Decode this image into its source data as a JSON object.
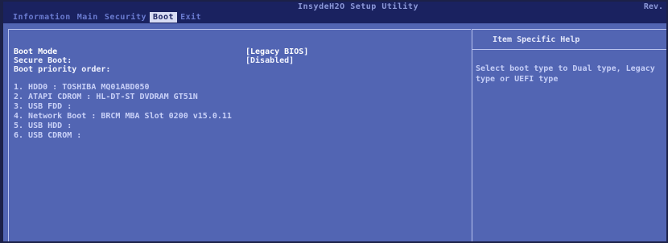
{
  "header": {
    "utility_title": "InsydeH2O Setup Utility",
    "revision": "Rev."
  },
  "menu": {
    "tabs": [
      {
        "label": "Information"
      },
      {
        "label": "Main"
      },
      {
        "label": "Security"
      },
      {
        "label": "Boot",
        "active": true
      },
      {
        "label": "Exit"
      }
    ]
  },
  "settings": {
    "boot_mode": {
      "label": "Boot Mode",
      "value": "[Legacy BIOS]"
    },
    "secure_boot": {
      "label": "Secure Boot:",
      "value": "[Disabled]"
    },
    "boot_priority_label": "Boot priority order:"
  },
  "boot_order": [
    "1. HDD0 : TOSHIBA MQ01ABD050",
    "2. ATAPI CDROM : HL-DT-ST DVDRAM GT51N",
    "3. USB FDD :",
    "4. Network Boot : BRCM MBA Slot 0200 v15.0.11",
    "5. USB HDD :",
    "6. USB CDROM :"
  ],
  "help": {
    "title": "Item Specific Help",
    "text": "Select boot type to Dual type, Legacy type or UEFI type"
  },
  "colors": {
    "background": "#5265b3",
    "topbar": "#1a2260",
    "active_tab": "#d8dcf4",
    "text_highlight": "#ffffff"
  }
}
